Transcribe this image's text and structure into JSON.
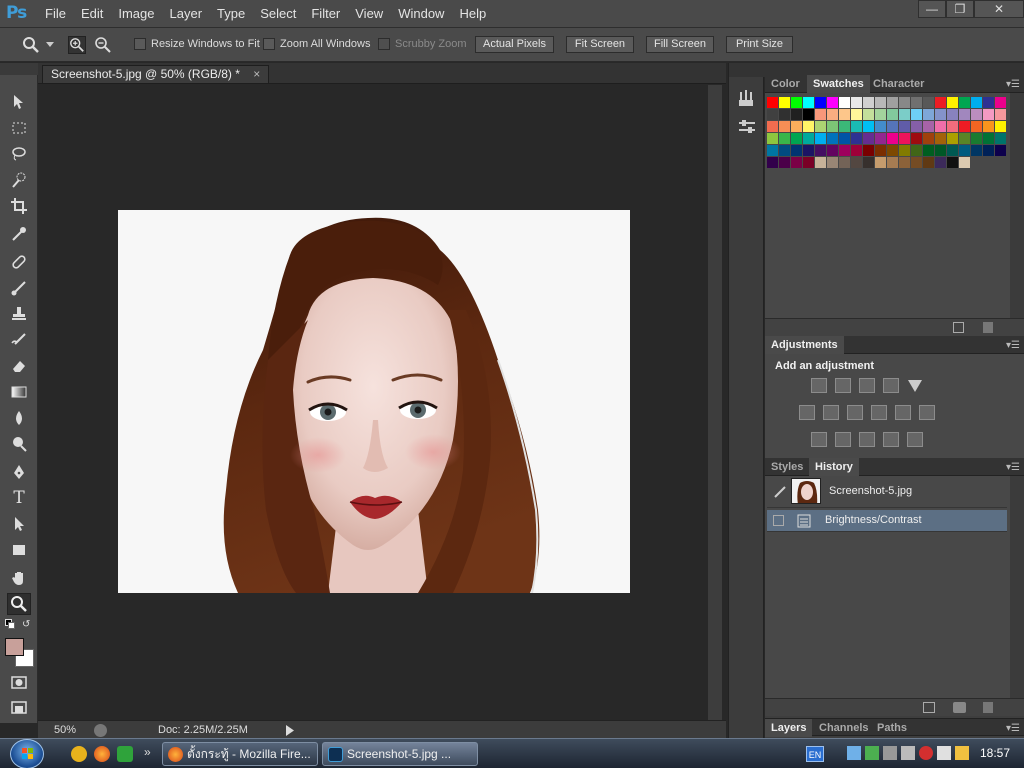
{
  "app": {
    "logo": "Ps"
  },
  "menu": [
    "File",
    "Edit",
    "Image",
    "Layer",
    "Type",
    "Select",
    "Filter",
    "View",
    "Window",
    "Help"
  ],
  "window_controls": {
    "minimize": "—",
    "restore": "❐",
    "close": "✕"
  },
  "options": {
    "resize_windows": "Resize Windows to Fit",
    "zoom_all": "Zoom All Windows",
    "scrubby_zoom": "Scrubby Zoom",
    "actual_pixels": "Actual Pixels",
    "fit_screen": "Fit Screen",
    "fill_screen": "Fill Screen",
    "print_size": "Print Size"
  },
  "document": {
    "tab_title": "Screenshot-5.jpg @ 50% (RGB/8) *",
    "close_glyph": "×",
    "zoom": "50%",
    "doc_size": "Doc: 2.25M/2.25M"
  },
  "panels": {
    "top_tabs": [
      "Color",
      "Swatches",
      "Character"
    ],
    "adjustments": {
      "tab": "Adjustments",
      "title": "Add an adjustment"
    },
    "history_tabs": [
      "Styles",
      "History"
    ],
    "history": {
      "snapshot": "Screenshot-5.jpg",
      "step": "Brightness/Contrast"
    },
    "bottom_tabs": [
      "Layers",
      "Channels",
      "Paths"
    ]
  },
  "colors": {
    "foreground": "#c8a09a",
    "background": "#ffffff",
    "accent": "#3f9dd8",
    "swatches": [
      "#ff0000",
      "#ffff00",
      "#00ff00",
      "#00ffff",
      "#0000ff",
      "#ff00ff",
      "#ffffff",
      "#e8e8e8",
      "#d0d0d0",
      "#b8b8b8",
      "#a0a0a0",
      "#888888",
      "#707070",
      "#585858",
      "#ec1c24",
      "#fff200",
      "#00a651",
      "#00aeef",
      "#2e3192",
      "#ec008c",
      "#404040",
      "#303030",
      "#202020",
      "#000000",
      "#f7977a",
      "#f9ad81",
      "#fdc68a",
      "#fff79a",
      "#c4df9b",
      "#a3d39c",
      "#82ca9d",
      "#7bcdc8",
      "#6ecff6",
      "#7ea7d8",
      "#8493ca",
      "#8882be",
      "#a187be",
      "#bc8dbf",
      "#f49ac2",
      "#f6989d",
      "#f26c4f",
      "#f68e55",
      "#fbaf5c",
      "#fff467",
      "#acd372",
      "#7cc576",
      "#3bb878",
      "#1abbb4",
      "#00bff3",
      "#438ccb",
      "#5574b9",
      "#605ca8",
      "#855fa8",
      "#a763a8",
      "#f06ea9",
      "#f26d7d",
      "#ed1c24",
      "#f26522",
      "#f7941d",
      "#fff200",
      "#8dc63f",
      "#39b54a",
      "#00a651",
      "#00a99d",
      "#00aeef",
      "#0072bc",
      "#0054a6",
      "#2e3192",
      "#662d91",
      "#92278f",
      "#ec008c",
      "#ed145b",
      "#9e0b0f",
      "#a0410d",
      "#a36209",
      "#aba000",
      "#598527",
      "#197b30",
      "#007236",
      "#00746b",
      "#0076a3",
      "#004b80",
      "#003471",
      "#1b1464",
      "#440e62",
      "#630460",
      "#9e005d",
      "#9e0039",
      "#790000",
      "#7b2e00",
      "#7d4900",
      "#827b00",
      "#406618",
      "#005e20",
      "#005826",
      "#005952",
      "#005b7f",
      "#003663",
      "#002157",
      "#0d004c",
      "#32004b",
      "#4b0049",
      "#7b0046",
      "#7a0026",
      "#c7b299",
      "#998675",
      "#736357",
      "#534741",
      "#37302d",
      "#c69c6d",
      "#a67c52",
      "#8c6239",
      "#754c24",
      "#603913",
      "#3c2a5a",
      "#111111",
      "#dccab0"
    ]
  }
}
